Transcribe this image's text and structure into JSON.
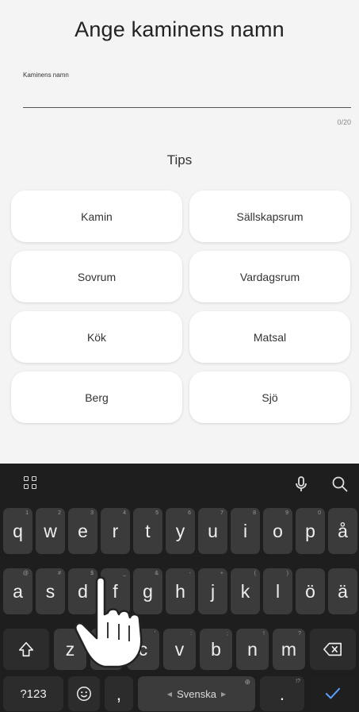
{
  "screen": {
    "title": "Ange kaminens namn",
    "field_label": "Kaminens namn",
    "field_value": "",
    "counter": "0/20",
    "tips_heading": "Tips"
  },
  "tips": [
    "Kamin",
    "Sällskapsrum",
    "Sovrum",
    "Vardagsrum",
    "Kök",
    "Matsal",
    "Berg",
    "Sjö"
  ],
  "keyboard": {
    "row1": [
      {
        "k": "q",
        "h": "1"
      },
      {
        "k": "w",
        "h": "2"
      },
      {
        "k": "e",
        "h": "3"
      },
      {
        "k": "r",
        "h": "4"
      },
      {
        "k": "t",
        "h": "5"
      },
      {
        "k": "y",
        "h": "6"
      },
      {
        "k": "u",
        "h": "7"
      },
      {
        "k": "i",
        "h": "8"
      },
      {
        "k": "o",
        "h": "9"
      },
      {
        "k": "p",
        "h": "0"
      },
      {
        "k": "å",
        "h": ""
      }
    ],
    "row2": [
      {
        "k": "a",
        "h": "@"
      },
      {
        "k": "s",
        "h": "#"
      },
      {
        "k": "d",
        "h": "$"
      },
      {
        "k": "f",
        "h": "_"
      },
      {
        "k": "g",
        "h": "&"
      },
      {
        "k": "h",
        "h": "-"
      },
      {
        "k": "j",
        "h": "+"
      },
      {
        "k": "k",
        "h": "("
      },
      {
        "k": "l",
        "h": ")"
      },
      {
        "k": "ö",
        "h": ""
      },
      {
        "k": "ä",
        "h": ""
      }
    ],
    "row3": [
      {
        "k": "z",
        "h": "*"
      },
      {
        "k": "x",
        "h": "\""
      },
      {
        "k": "c",
        "h": "'"
      },
      {
        "k": "v",
        "h": ":"
      },
      {
        "k": "b",
        "h": ";"
      },
      {
        "k": "n",
        "h": "!"
      },
      {
        "k": "m",
        "h": "?"
      }
    ],
    "symbols_key": "?123",
    "comma_key": ",",
    "space_label": "Svenska",
    "period_key": ".",
    "period_hint": "!?"
  }
}
